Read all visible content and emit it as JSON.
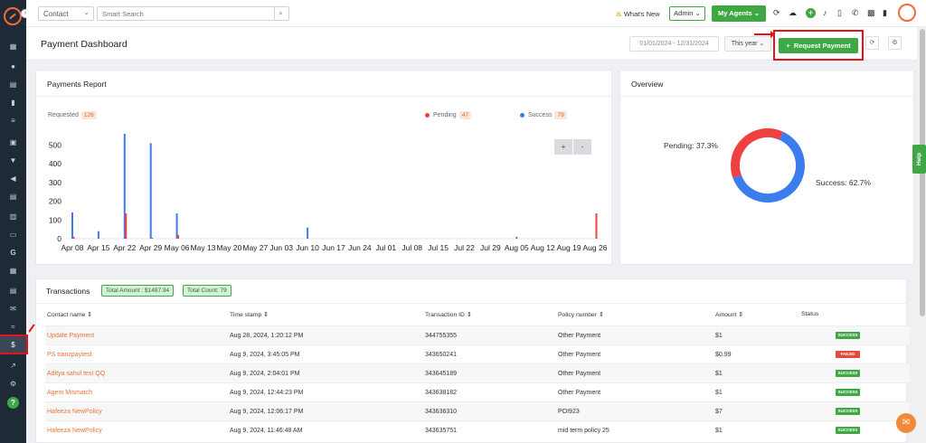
{
  "topbar": {
    "contact_select": "Contact",
    "search_placeholder": "Smart Search",
    "whats_new": "What's New",
    "admin": "Admin",
    "my_agents": "My Agents"
  },
  "header": {
    "title": "Payment Dashboard",
    "date_range": "01/01/2024 - 12/31/2024",
    "period": "This year",
    "request_payment": "Request Payment"
  },
  "report": {
    "title": "Payments Report",
    "requested_label": "Requested",
    "requested_count": "126",
    "pending_label": "Pending",
    "pending_count": "47",
    "success_label": "Success",
    "success_count": "79",
    "zoom_in": "+",
    "zoom_out": "-"
  },
  "overview": {
    "title": "Overview",
    "pending_label": "Pending: 37.3%",
    "success_label": "Success: 62.7%"
  },
  "transactions": {
    "title": "Transactions",
    "total_amount": "Total Amount : $1487.94",
    "total_count": "Total Count: 79",
    "columns": [
      "Contact name",
      "Time stamp",
      "Transaction ID",
      "Policy number",
      "Amount",
      "Status"
    ],
    "rows": [
      {
        "contact": "Update Payment",
        "time": "Aug 28, 2024, 1:20:12 PM",
        "txid": "344755355",
        "policy": "Other Payment",
        "amount": "$1",
        "status": "SUCCESS"
      },
      {
        "contact": "PS tranzpaytest",
        "time": "Aug 9, 2024, 3:45:05 PM",
        "txid": "343650241",
        "policy": "Other Payment",
        "amount": "$0.99",
        "status": "FAILED"
      },
      {
        "contact": "Aditya sahul test QQ",
        "time": "Aug 9, 2024, 2:04:01 PM",
        "txid": "343645189",
        "policy": "Other Payment",
        "amount": "$1",
        "status": "SUCCESS"
      },
      {
        "contact": "Agent Mismatch",
        "time": "Aug 9, 2024, 12:44:23 PM",
        "txid": "343638182",
        "policy": "Other Payment",
        "amount": "$1",
        "status": "SUCCESS"
      },
      {
        "contact": "Hafeeza NewPolicy",
        "time": "Aug 9, 2024, 12:06:17 PM",
        "txid": "343636310",
        "policy": "POI923",
        "amount": "$7",
        "status": "SUCCESS"
      },
      {
        "contact": "Hafeeza NewPolicy",
        "time": "Aug 9, 2024, 11:46:48 AM",
        "txid": "343635751",
        "policy": "mid term policy 25",
        "amount": "$1",
        "status": "SUCCESS"
      }
    ]
  },
  "help_tab": "Help",
  "colors": {
    "accent": "#3fa845",
    "pending": "#f04141",
    "success": "#3b7ded",
    "requested": "#3b7ded",
    "link": "#e8743b"
  },
  "chart_data": [
    {
      "type": "bar",
      "title": "Payments Report",
      "categories": [
        "Apr 08",
        "Apr 15",
        "Apr 22",
        "Apr 29",
        "May 06",
        "May 13",
        "May 20",
        "May 27",
        "Jun 03",
        "Jun 10",
        "Jun 17",
        "Jun 24",
        "Jul 01",
        "Jul 08",
        "Jul 15",
        "Jul 22",
        "Jul 29",
        "Aug 05",
        "Aug 12",
        "Aug 19",
        "Aug 26"
      ],
      "ylim": [
        0,
        560
      ],
      "yticks": [
        0,
        100,
        200,
        300,
        400,
        500
      ],
      "series": [
        {
          "name": "Success",
          "color": "#3b7ded",
          "values": [
            140,
            40,
            560,
            510,
            135,
            0,
            0,
            0,
            0,
            60,
            0,
            0,
            0,
            0,
            0,
            0,
            0,
            10,
            0,
            0,
            0
          ]
        },
        {
          "name": "Pending",
          "color": "#f04141",
          "values": [
            10,
            0,
            135,
            5,
            20,
            0,
            0,
            0,
            0,
            0,
            0,
            0,
            0,
            0,
            0,
            0,
            0,
            0,
            0,
            0,
            135
          ]
        }
      ]
    },
    {
      "type": "pie",
      "title": "Overview",
      "labels": [
        "Pending",
        "Success"
      ],
      "values": [
        37.3,
        62.7
      ],
      "colors": [
        "#f04141",
        "#3b7ded"
      ]
    }
  ]
}
